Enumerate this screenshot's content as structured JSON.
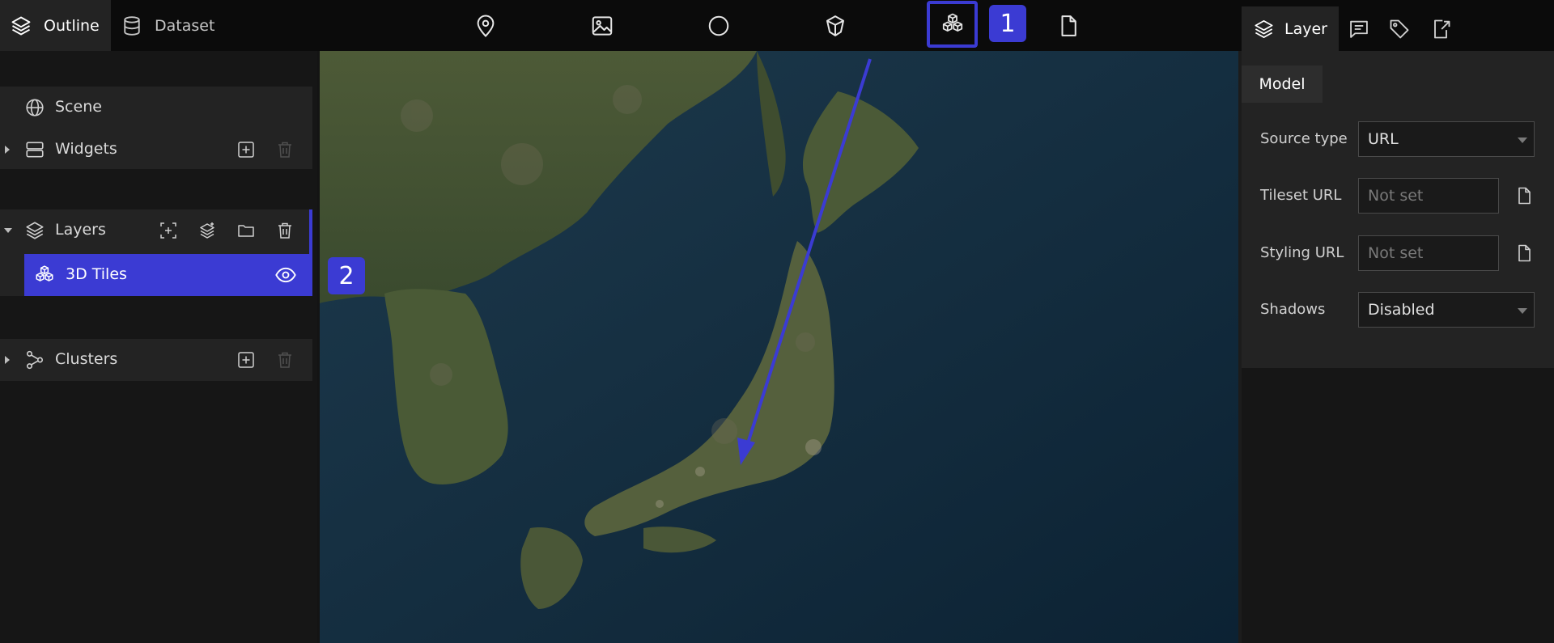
{
  "left_tabs": {
    "outline": "Outline",
    "dataset": "Dataset"
  },
  "toolbar": {
    "tools": [
      "marker-icon",
      "photo-icon",
      "circle-icon",
      "model-icon",
      "3d-tiles-icon",
      "file-icon"
    ],
    "annotation_1": "1",
    "annotation_2": "2"
  },
  "right_tabs": {
    "layer": "Layer"
  },
  "outline": {
    "scene": "Scene",
    "widgets": "Widgets",
    "layers": "Layers",
    "selected_layer": "3D Tiles",
    "clusters": "Clusters"
  },
  "properties": {
    "tab": "Model",
    "source_type_label": "Source type",
    "source_type_value": "URL",
    "tileset_url_label": "Tileset URL",
    "tileset_url_placeholder": "Not set",
    "styling_url_label": "Styling URL",
    "styling_url_placeholder": "Not set",
    "shadows_label": "Shadows",
    "shadows_value": "Disabled"
  },
  "colors": {
    "accent": "#3b3bd3",
    "panel": "#232323",
    "background": "#161616",
    "topbar": "#0b0b0b"
  }
}
